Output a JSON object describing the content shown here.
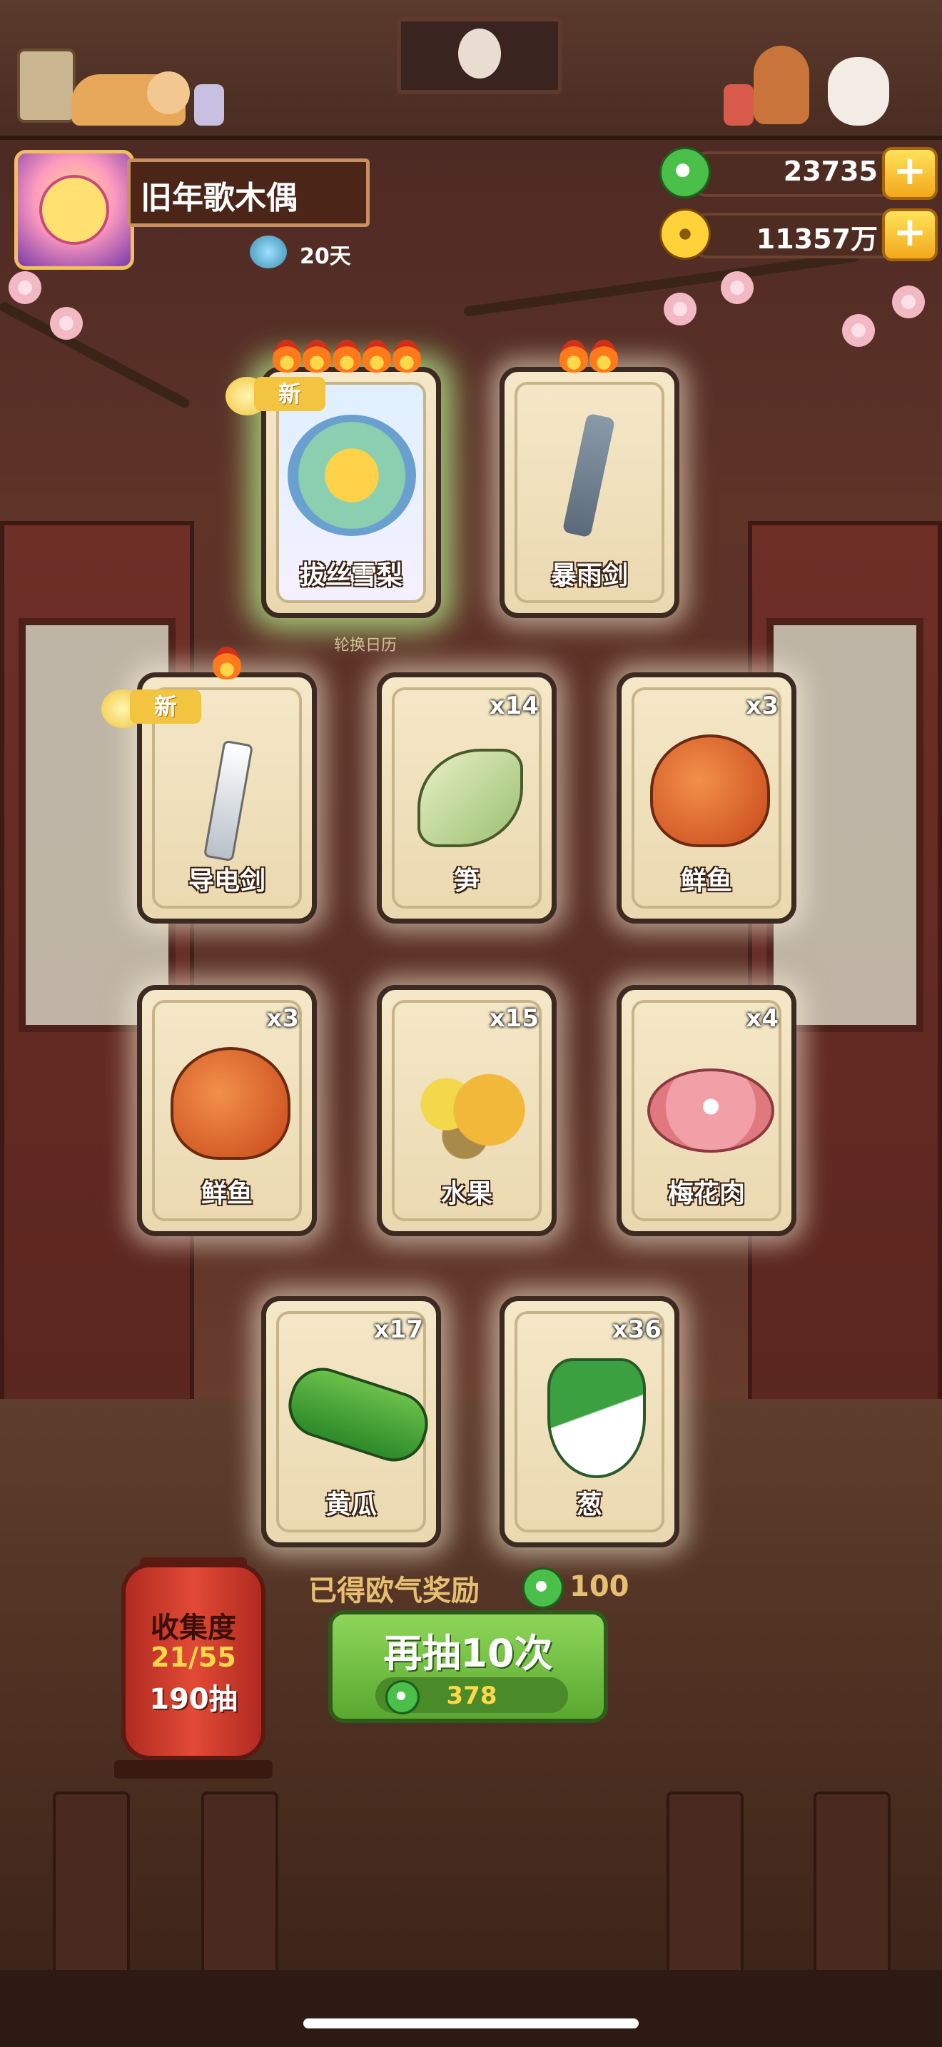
{
  "player": {
    "name": "旧年歌木偶",
    "days": "20天",
    "avatar_icon": "player-avatar"
  },
  "currency": {
    "jade": {
      "value": "23735",
      "icon": "jade-icon",
      "color": "#4ac04a"
    },
    "coins": {
      "value": "11357万",
      "icon": "coin-icon",
      "color": "#ffd23a"
    },
    "add_label": "+"
  },
  "background": {
    "calendar_label": "轮换日历"
  },
  "cards": [
    {
      "name": "拔丝雪梨",
      "count": "",
      "stars": 5,
      "new": true,
      "new_label": "新",
      "icon": "candied-pear-dish-icon",
      "rare": true
    },
    {
      "name": "暴雨剑",
      "count": "",
      "stars": 2,
      "new": false,
      "icon": "rain-sword-icon",
      "rare": false
    },
    {
      "name": "导电剑",
      "count": "",
      "stars": 1,
      "new": true,
      "new_label": "新",
      "icon": "conductive-sword-icon",
      "rare": false
    },
    {
      "name": "笋",
      "count": "x14",
      "stars": 0,
      "new": false,
      "icon": "bamboo-shoot-icon",
      "rare": false
    },
    {
      "name": "鲜鱼",
      "count": "x3",
      "stars": 0,
      "new": false,
      "icon": "fresh-fish-icon",
      "rare": false
    },
    {
      "name": "鲜鱼",
      "count": "x3",
      "stars": 0,
      "new": false,
      "icon": "fresh-fish-icon",
      "rare": false
    },
    {
      "name": "水果",
      "count": "x15",
      "stars": 0,
      "new": false,
      "icon": "fruit-icon",
      "rare": false
    },
    {
      "name": "梅花肉",
      "count": "x4",
      "stars": 0,
      "new": false,
      "icon": "pork-icon",
      "rare": false
    },
    {
      "name": "黄瓜",
      "count": "x17",
      "stars": 0,
      "new": false,
      "icon": "cucumber-icon",
      "rare": false
    },
    {
      "name": "葱",
      "count": "x36",
      "stars": 0,
      "new": false,
      "icon": "scallion-icon",
      "rare": false
    }
  ],
  "reward": {
    "label": "已得欧气奖励",
    "value": "100",
    "icon": "jade-icon"
  },
  "draw_button": {
    "label": "再抽10次",
    "cost": "378",
    "icon": "jade-icon"
  },
  "collection": {
    "title": "收集度",
    "progress": "21/55",
    "draws": "190抽"
  }
}
